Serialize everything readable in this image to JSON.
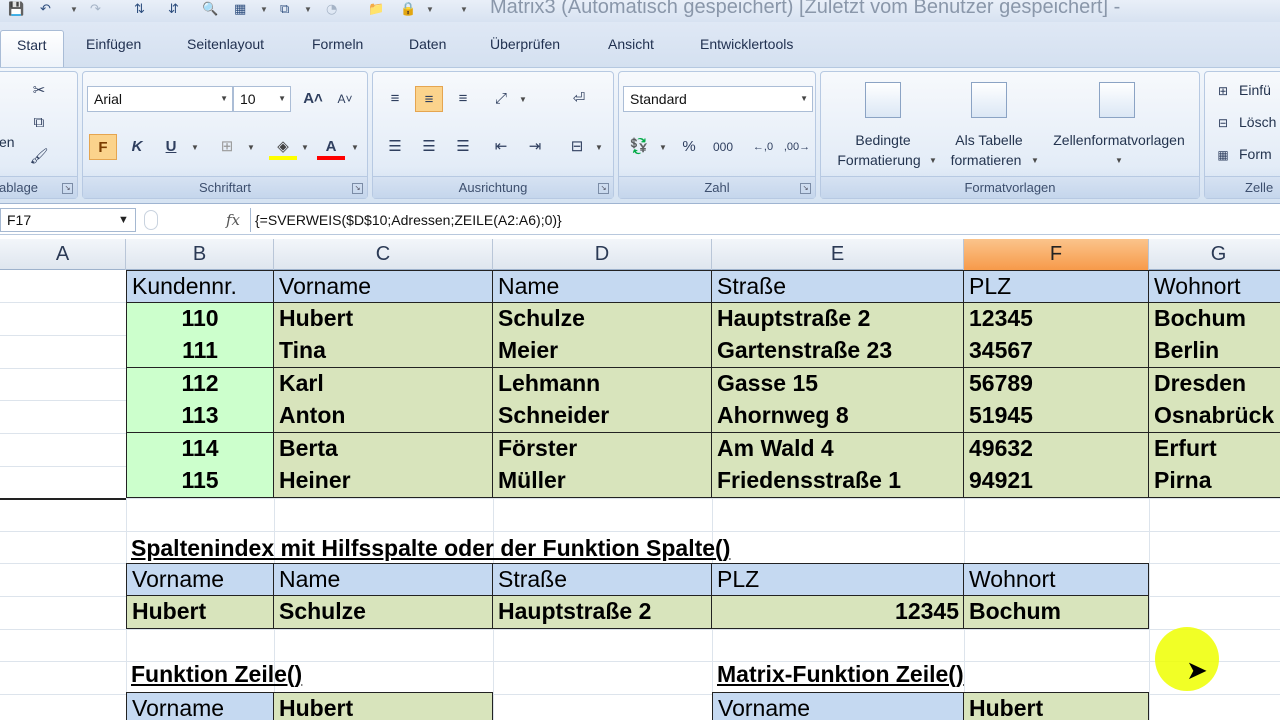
{
  "window": {
    "title": "Matrix3 (Automatisch gespeichert) [Zuletzt vom Benutzer gespeichert] -"
  },
  "ribbon_tabs": [
    "Start",
    "Einfügen",
    "Seitenlayout",
    "Formeln",
    "Daten",
    "Überprüfen",
    "Ansicht",
    "Entwicklertools"
  ],
  "ribbon": {
    "clipboard": {
      "label": "ablage",
      "paste_label": "en"
    },
    "font": {
      "label": "Schriftart",
      "font_name": "Arial",
      "font_size": "10",
      "bold": "F",
      "italic": "K",
      "underline": "U",
      "font_color": "A"
    },
    "alignment": {
      "label": "Ausrichtung"
    },
    "number": {
      "label": "Zahl",
      "format": "Standard",
      "percent": "%",
      "thousands": "000"
    },
    "styles": {
      "label": "Formatvorlagen",
      "conditional_line1": "Bedingte",
      "conditional_line2": "Formatierung",
      "table_line1": "Als Tabelle",
      "table_line2": "formatieren",
      "cellstyles": "Zellenformatvorlagen"
    },
    "cells": {
      "label": "Zelle",
      "insert": "Einfü",
      "delete": "Lösch",
      "format": "Form"
    }
  },
  "formula_bar": {
    "name_box": "F17",
    "fx": "fx",
    "formula": "{=SVERWEIS($D$10;Adressen;ZEILE(A2:A6);0)}"
  },
  "columns": [
    "A",
    "B",
    "C",
    "D",
    "E",
    "F",
    "G"
  ],
  "selected_column": "F",
  "address_table": {
    "headers": [
      "Kundennr.",
      "Vorname",
      "Name",
      "Straße",
      "PLZ",
      "Wohnort"
    ],
    "rows": [
      [
        "110",
        "Hubert",
        "Schulze",
        "Hauptstraße 2",
        "12345",
        "Bochum"
      ],
      [
        "111",
        "Tina",
        "Meier",
        "Gartenstraße 23",
        "34567",
        "Berlin"
      ],
      [
        "112",
        "Karl",
        "Lehmann",
        "Gasse 15",
        "56789",
        "Dresden"
      ],
      [
        "113",
        "Anton",
        "Schneider",
        "Ahornweg 8",
        "51945",
        "Osnabrück"
      ],
      [
        "114",
        "Berta",
        "Förster",
        "Am Wald 4",
        "49632",
        "Erfurt"
      ],
      [
        "115",
        "Heiner",
        "Müller",
        "Friedensstraße 1",
        "94921",
        "Pirna"
      ]
    ]
  },
  "section_spalte": {
    "caption": "Spaltenindex mit Hilfsspalte oder der Funktion Spalte()",
    "headers": [
      "Vorname",
      "Name",
      "Straße",
      "PLZ",
      "Wohnort"
    ],
    "values": [
      "Hubert",
      "Schulze",
      "Hauptstraße 2",
      "12345",
      "Bochum"
    ]
  },
  "section_zeile": {
    "caption": "Funktion Zeile()",
    "label": "Vorname",
    "value": "Hubert"
  },
  "section_matrix": {
    "caption": "Matrix-Funktion Zeile()",
    "label": "Vorname",
    "value": "Hubert"
  },
  "colors": {
    "header_blue": "#c5d9f1",
    "data_green": "#d8e4bc",
    "id_green": "#ccffcc",
    "selected_column": "#f79a4a",
    "cursor_highlight": "#eeff00"
  }
}
